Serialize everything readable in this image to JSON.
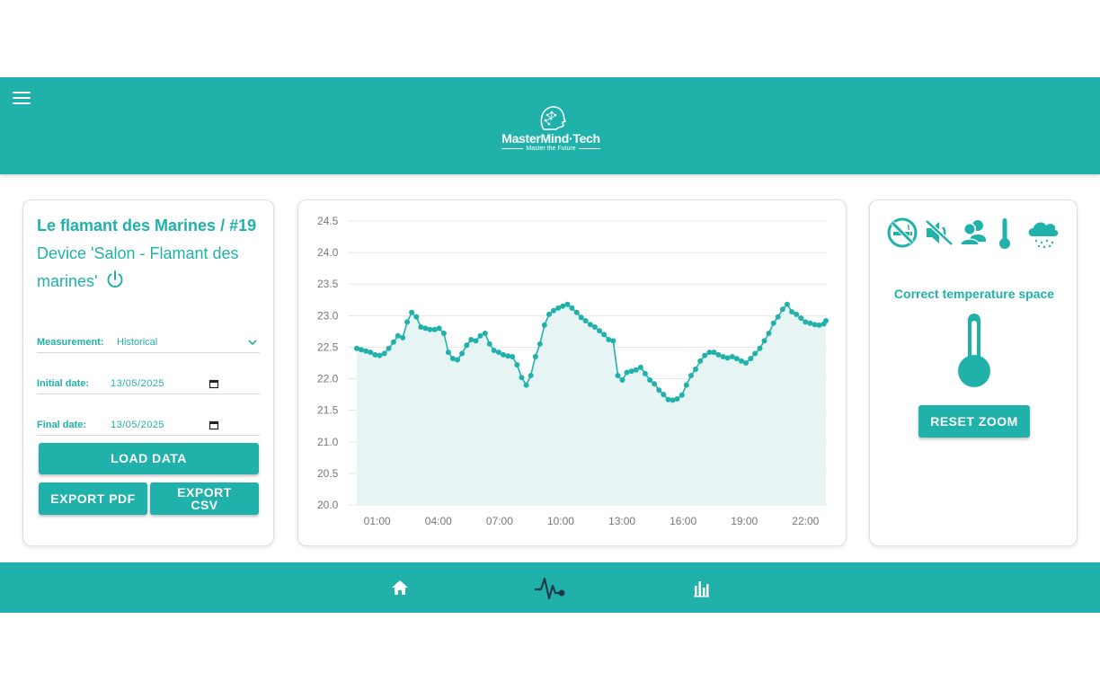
{
  "header": {
    "logo_name": "MasterMind·Tech",
    "logo_tagline": "Master the Future"
  },
  "device": {
    "title": "Le flamant des Marines / #19",
    "subtitle": "Device 'Salon - Flamant des marines'"
  },
  "form": {
    "measurement_label": "Measurement:",
    "measurement_value": "Historical",
    "initial_label": "Initial date:",
    "initial_value": "13/05/2025",
    "final_label": "Final date:",
    "final_value": "13/05/2025"
  },
  "buttons": {
    "load": "LOAD DATA",
    "export_pdf": "EXPORT PDF",
    "export_csv_line1": "EXPORT",
    "export_csv_line2": "CSV",
    "reset_zoom": "RESET ZOOM"
  },
  "status": {
    "label": "Correct temperature space",
    "icons": [
      "no-smoking-icon",
      "mute-icon",
      "people-icon",
      "thermometer-icon",
      "rain-cloud-icon"
    ]
  },
  "footer": {
    "icons": [
      "home-icon",
      "pulse-icon",
      "bar-chart-icon"
    ]
  },
  "colors": {
    "accent": "#20b2aa",
    "accent_dark": "#1f3a4a",
    "chart_fill": "#e6f5f4"
  },
  "chart_data": {
    "type": "area",
    "ylim": [
      20.0,
      24.5
    ],
    "yticks": [
      "20.0",
      "20.5",
      "21.0",
      "21.5",
      "22.0",
      "22.5",
      "23.0",
      "23.5",
      "24.0",
      "24.5"
    ],
    "xticks": [
      "01:00",
      "04:00",
      "07:00",
      "10:00",
      "13:00",
      "16:00",
      "19:00",
      "22:00"
    ],
    "grid": true,
    "x_range_hours": [
      0,
      23
    ],
    "series": [
      {
        "x": [
          0.0,
          0.22,
          0.45,
          0.67,
          0.9,
          1.12,
          1.35,
          1.57,
          1.8,
          2.02,
          2.25,
          2.47,
          2.69,
          2.92,
          3.14,
          3.37,
          3.59,
          3.82,
          4.04,
          4.27,
          4.49,
          4.71,
          4.94,
          5.16,
          5.39,
          5.61,
          5.84,
          6.06,
          6.29,
          6.51,
          6.73,
          6.96,
          7.18,
          7.41,
          7.63,
          7.86,
          8.08,
          8.31,
          8.53,
          8.76,
          8.98,
          9.2,
          9.43,
          9.65,
          9.88,
          10.1,
          10.33,
          10.55,
          10.78,
          11.0,
          11.22,
          11.45,
          11.67,
          11.9,
          12.12,
          12.35,
          12.57,
          12.8,
          13.02,
          13.24,
          13.47,
          13.69,
          13.92,
          14.14,
          14.37,
          14.59,
          14.82,
          15.04,
          15.27,
          15.49,
          15.71,
          15.94,
          16.16,
          16.39,
          16.61,
          16.84,
          17.06,
          17.29,
          17.51,
          17.73,
          17.96,
          18.18,
          18.41,
          18.63,
          18.86,
          19.08,
          19.31,
          19.53,
          19.76,
          19.98,
          20.2,
          20.43,
          20.65,
          20.88,
          21.1,
          21.33,
          21.55,
          21.78,
          22.0,
          22.22,
          22.45,
          22.67,
          22.9,
          23.0
        ],
        "y": [
          22.48,
          22.46,
          22.44,
          22.42,
          22.38,
          22.37,
          22.4,
          22.48,
          22.58,
          22.68,
          22.65,
          22.9,
          23.05,
          22.98,
          22.82,
          22.8,
          22.78,
          22.78,
          22.8,
          22.72,
          22.42,
          22.32,
          22.3,
          22.4,
          22.53,
          22.62,
          22.6,
          22.68,
          22.72,
          22.55,
          22.45,
          22.42,
          22.38,
          22.36,
          22.35,
          22.22,
          22.02,
          21.9,
          22.05,
          22.35,
          22.55,
          22.85,
          23.02,
          23.08,
          23.12,
          23.15,
          23.18,
          23.12,
          23.05,
          22.97,
          22.92,
          22.86,
          22.82,
          22.76,
          22.7,
          22.62,
          22.6,
          22.05,
          21.98,
          22.1,
          22.12,
          22.14,
          22.18,
          22.08,
          21.98,
          21.92,
          21.82,
          21.75,
          21.67,
          21.66,
          21.68,
          21.74,
          21.9,
          22.05,
          22.15,
          22.28,
          22.37,
          22.42,
          22.42,
          22.38,
          22.35,
          22.33,
          22.35,
          22.32,
          22.28,
          22.25,
          22.32,
          22.4,
          22.48,
          22.6,
          22.72,
          22.88,
          22.98,
          23.1,
          23.18,
          23.06,
          23.02,
          22.96,
          22.9,
          22.88,
          22.86,
          22.85,
          22.87,
          22.92
        ]
      }
    ]
  }
}
